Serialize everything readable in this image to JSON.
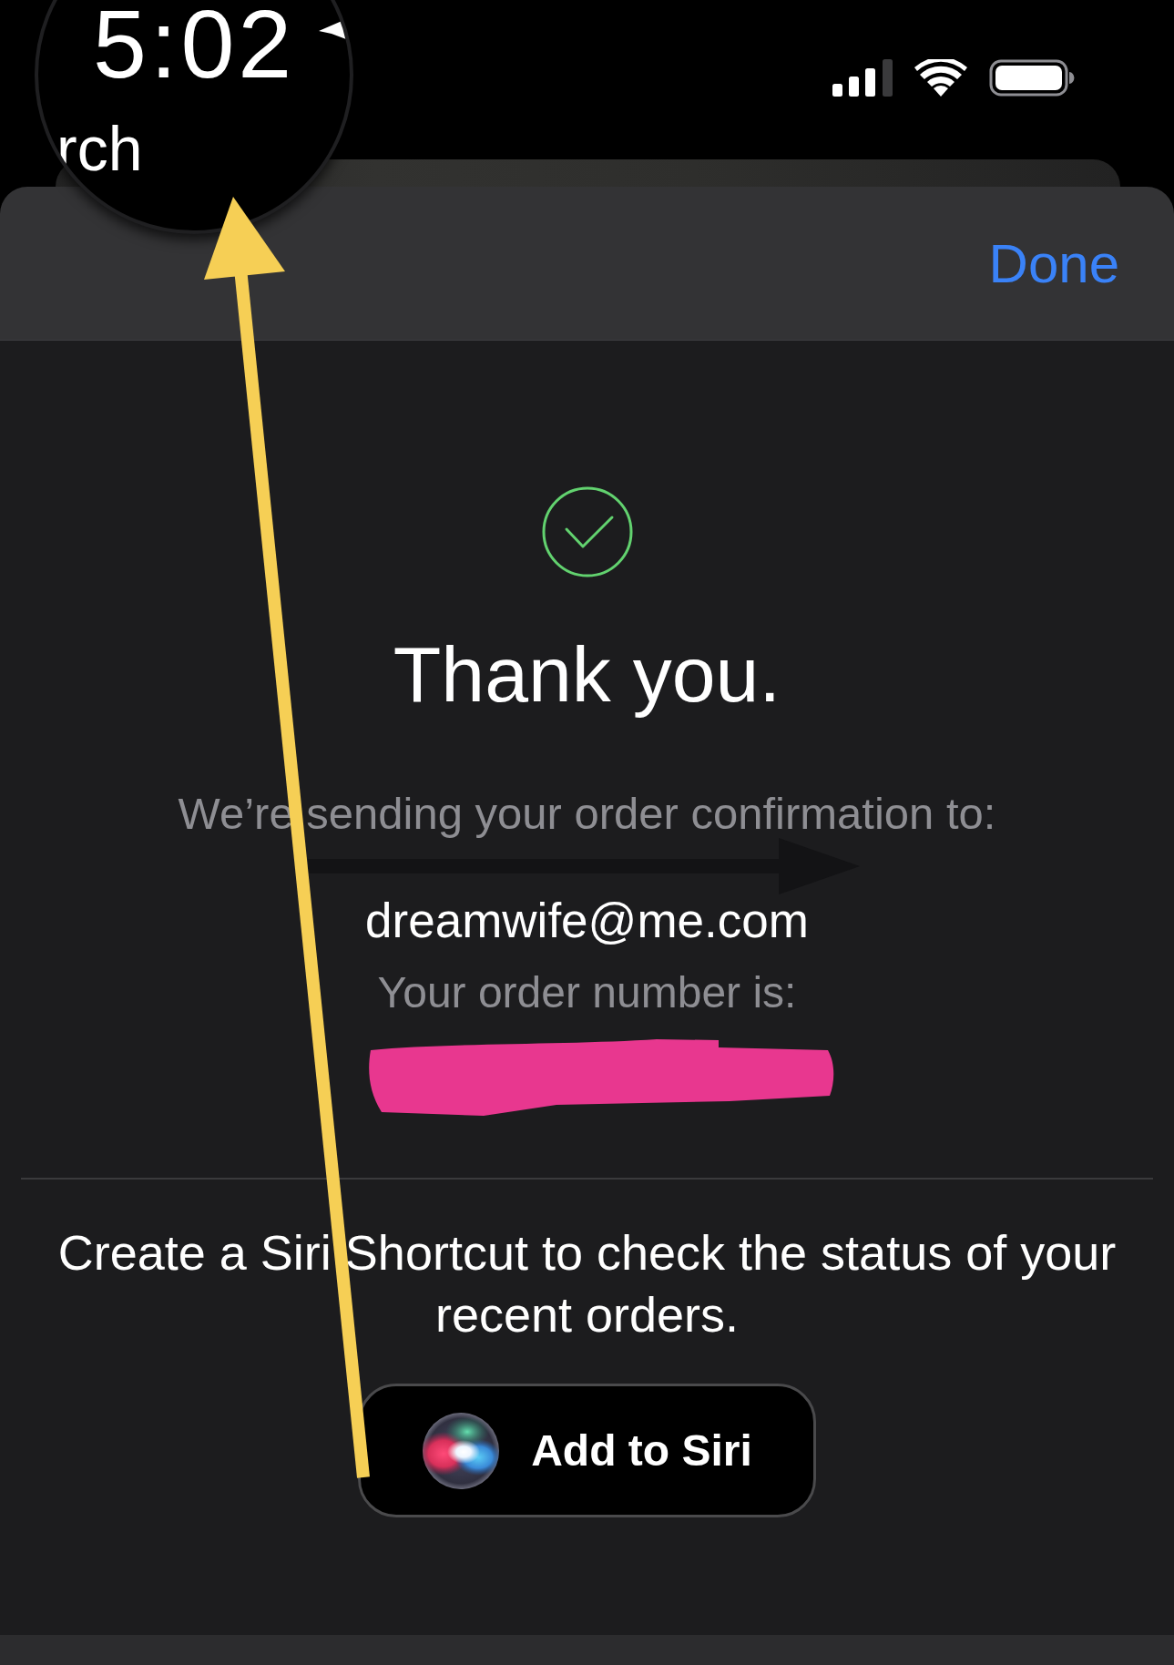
{
  "magnifier": {
    "time": "5:02",
    "text": "rch"
  },
  "sheet_header": {
    "done_button": "Done"
  },
  "confirmation": {
    "title": "Thank you.",
    "sending_label": "We’re sending your order confirmation to:",
    "email": "dreamwife@me.com",
    "order_number_label": "Your order number is:"
  },
  "siri_shortcut": {
    "prompt": "Create a Siri Shortcut to check the status of your recent orders.",
    "button": "Add to Siri"
  }
}
